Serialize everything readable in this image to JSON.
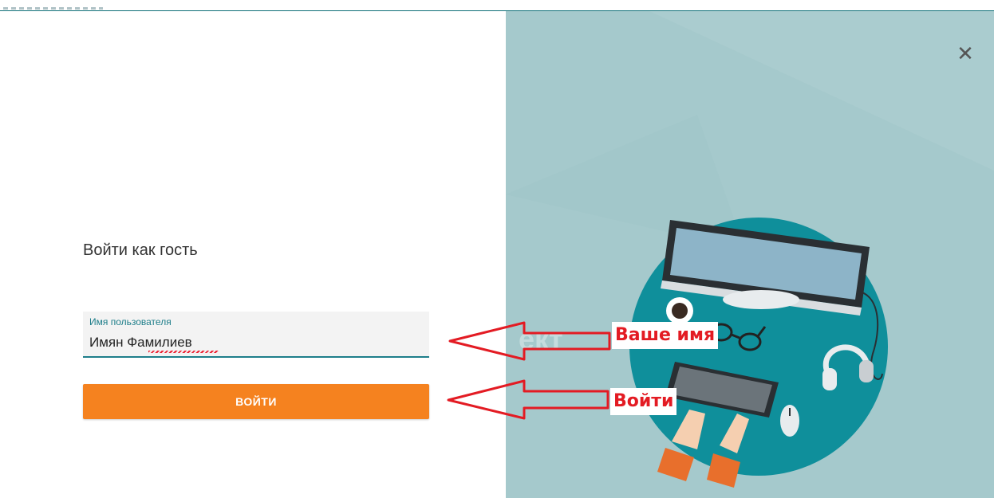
{
  "login": {
    "title": "Войти как гость",
    "username_label": "Имя пользователя",
    "username_value": "Имян Фамилиев",
    "submit_label": "ВОЙТИ"
  },
  "dialog": {
    "close_symbol": "✕"
  },
  "annotations": {
    "name_hint": "Ваше имя",
    "login_hint": "Войти"
  },
  "watermark": "ект",
  "colors": {
    "accent": "#1e7e8a",
    "button": "#f5821f",
    "panel": "#a5c9cc",
    "circle": "#0f8f9b",
    "annotation": "#e31b23"
  }
}
